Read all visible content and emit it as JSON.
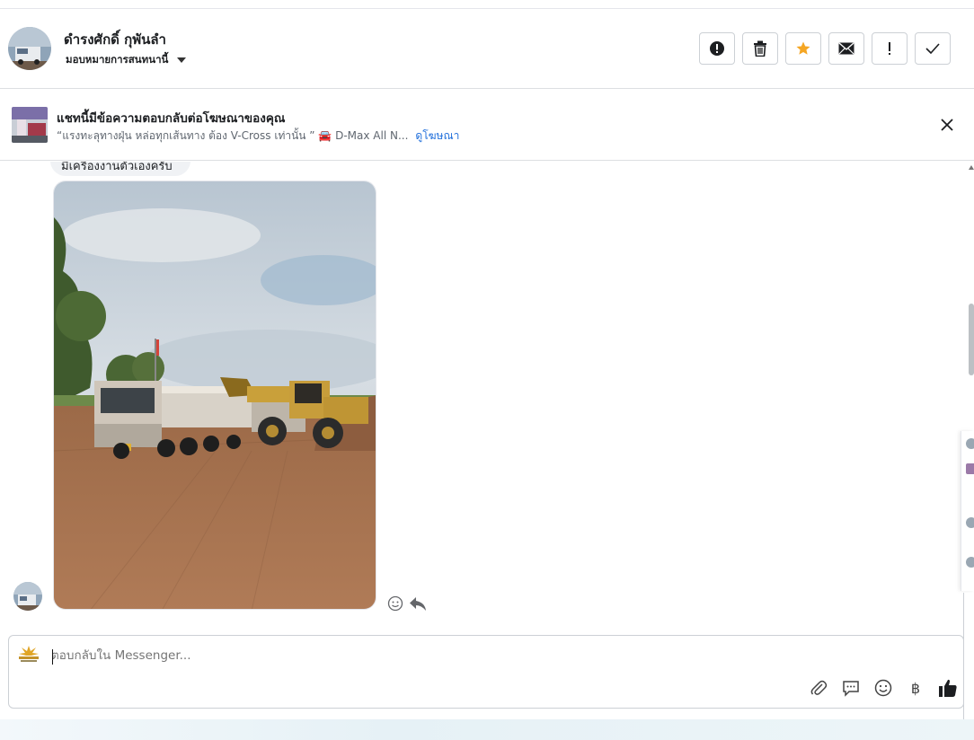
{
  "header": {
    "contact_name": "ดำรงศักดิ์ กุพันลำ",
    "assign_label": "มอบหมายการสนทนานี้",
    "actions": [
      {
        "name": "spam-button",
        "icon": "alert-circle-icon"
      },
      {
        "name": "delete-button",
        "icon": "trash-icon"
      },
      {
        "name": "star-button",
        "icon": "star-icon"
      },
      {
        "name": "mark-unread-button",
        "icon": "envelope-icon"
      },
      {
        "name": "follow-up-button",
        "icon": "exclamation-icon"
      },
      {
        "name": "mark-done-button",
        "icon": "check-icon"
      }
    ]
  },
  "ad_banner": {
    "title": "แชทนี้มีข้อความตอบกลับต่อโฆษณาของคุณ",
    "snippet": "“แรงทะลุทางฝุ่น หล่อทุกเส้นทาง ต้อง V-Cross เท่านั้น ” 🚘 D-Max All N...",
    "link": "ดูโฆษณา"
  },
  "chat": {
    "previous_bubble_text": "มีเครื่องงานตัวเองครับ"
  },
  "composer": {
    "placeholder": "ตอบกลับใน Messenger...",
    "tools": [
      "attachment-icon",
      "saved-reply-icon",
      "emoji-icon",
      "baht-icon",
      "thumbs-up-icon"
    ],
    "baht_symbol": "฿"
  },
  "colors": {
    "star": "#f5a623",
    "link": "#216fdb",
    "border": "#ccd0d5"
  }
}
